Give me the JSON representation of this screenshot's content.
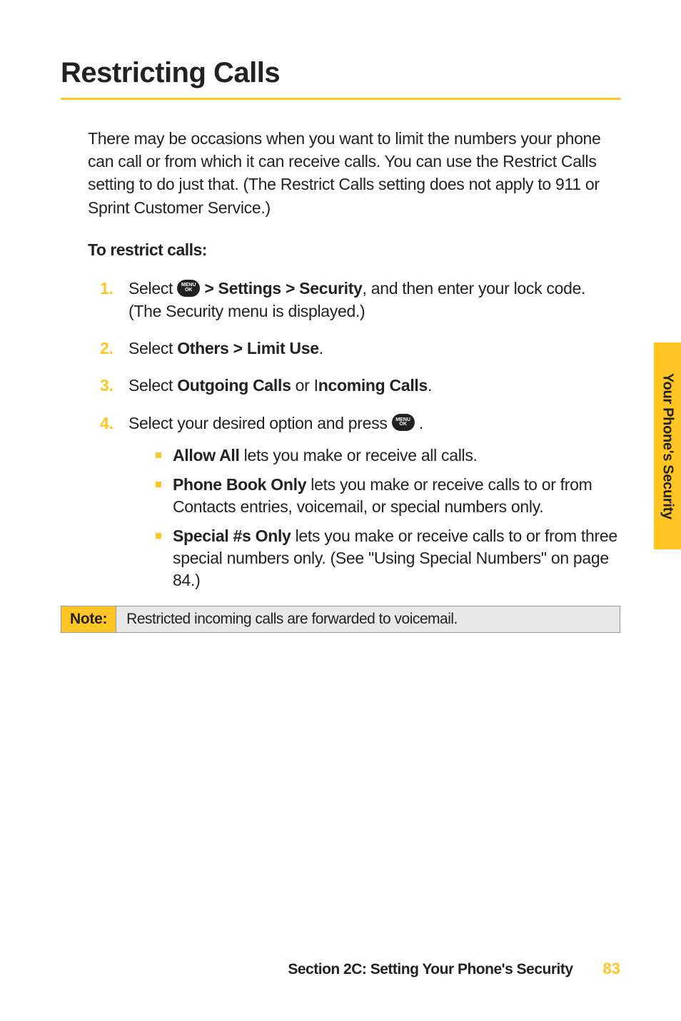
{
  "title": "Restricting Calls",
  "intro": "There may be occasions when you want to limit the numbers your phone can call or from which it can receive calls. You can use the Restrict Calls setting to do just that. (The Restrict Calls setting does not apply to 911 or Sprint Customer Service.)",
  "subheading": "To restrict calls:",
  "menu_icon_label": "MENU\nOK",
  "steps": {
    "s1_prefix": "Select ",
    "s1_bold": " > Settings > Security",
    "s1_suffix": ", and then enter your lock code. (The Security menu is displayed.)",
    "s2_prefix": "Select ",
    "s2_bold": "Others > Limit Use",
    "s2_suffix": ".",
    "s3_prefix": "Select ",
    "s3_bold1": "Outgoing Calls",
    "s3_mid": " or I",
    "s3_bold2": "ncoming Calls",
    "s3_suffix": ".",
    "s4_prefix": "Select your desired option and press ",
    "s4_suffix": " .",
    "bullets": {
      "b1_bold": "Allow All",
      "b1_text": " lets you make or receive all calls.",
      "b2_bold": "Phone Book Only",
      "b2_text": " lets you make or receive calls to or from Contacts entries, voicemail, or special numbers only.",
      "b3_bold": "Special #s Only",
      "b3_text": " lets you make or receive calls to or from three special numbers only. (See \"Using Special Numbers\" on page 84.)"
    }
  },
  "note": {
    "label": "Note:",
    "text": "Restricted incoming calls are forwarded to voicemail."
  },
  "side_tab": "Your Phone's Security",
  "footer": {
    "section": "Section 2C: Setting Your Phone's Security",
    "page": "83"
  }
}
